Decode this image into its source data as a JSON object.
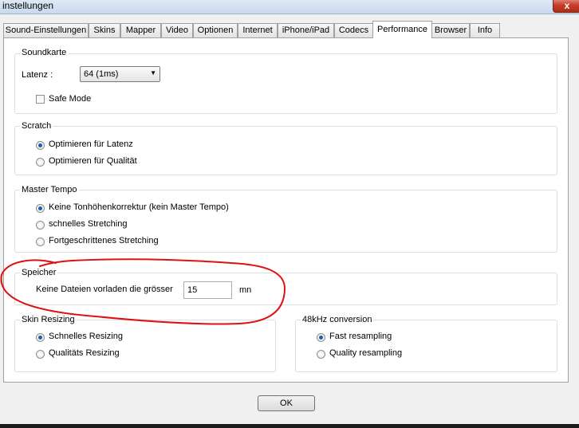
{
  "window": {
    "title": "instellungen",
    "close_glyph": "x"
  },
  "tabs": [
    {
      "label": "Sound-Einstellungen"
    },
    {
      "label": "Skins"
    },
    {
      "label": "Mapper"
    },
    {
      "label": "Video"
    },
    {
      "label": "Optionen"
    },
    {
      "label": "Internet"
    },
    {
      "label": "iPhone/iPad"
    },
    {
      "label": "Codecs"
    },
    {
      "label": "Performance",
      "active": true
    },
    {
      "label": "Browser"
    },
    {
      "label": "Info"
    }
  ],
  "soundkarte": {
    "title": "Soundkarte",
    "latency_label": "Latenz :",
    "latency_value": "64 (1ms)",
    "safe_mode_label": "Safe Mode",
    "safe_mode_checked": false
  },
  "scratch": {
    "title": "Scratch",
    "options": [
      {
        "label": "Optimieren für Latenz",
        "selected": true
      },
      {
        "label": "Optimieren für Qualität",
        "selected": false
      }
    ]
  },
  "master_tempo": {
    "title": "Master Tempo",
    "options": [
      {
        "label": "Keine Tonhöhenkorrektur (kein Master Tempo)",
        "selected": true
      },
      {
        "label": "schnelles Stretching",
        "selected": false
      },
      {
        "label": "Fortgeschrittenes Stretching",
        "selected": false
      }
    ]
  },
  "speicher": {
    "title": "Speicher",
    "label": "Keine Dateien vorladen die grösser",
    "value": "15",
    "unit": "mn"
  },
  "skin_resizing": {
    "title": "Skin Resizing",
    "options": [
      {
        "label": "Schnelles Resizing",
        "selected": true
      },
      {
        "label": "Qualitäts Resizing",
        "selected": false
      }
    ]
  },
  "conversion": {
    "title": "48kHz conversion",
    "options": [
      {
        "label": "Fast resampling",
        "selected": true
      },
      {
        "label": "Quality resampling",
        "selected": false
      }
    ]
  },
  "ok_label": "OK",
  "colors": {
    "annotation_stroke": "#e01010",
    "radio_dot": "#1f5ea8"
  }
}
